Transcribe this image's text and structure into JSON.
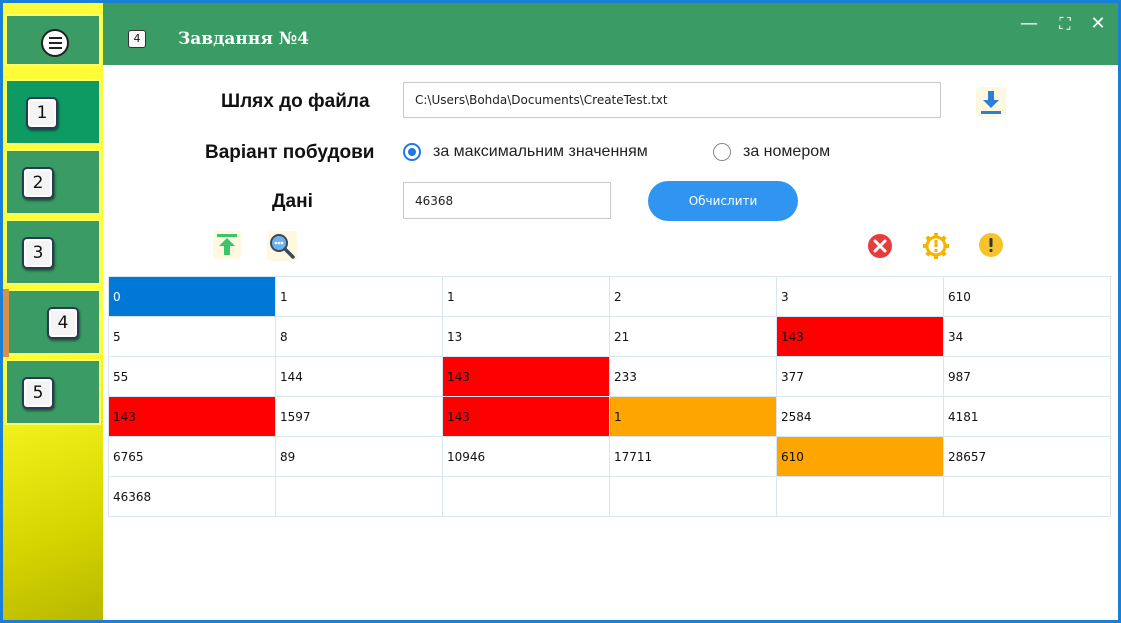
{
  "header": {
    "title": "Завдання №4",
    "task_badge": "4",
    "controls": {
      "minimize": "—",
      "maximize": "⛶",
      "close": "✕"
    }
  },
  "sidebar": {
    "menu_icon": "hamburger-menu-icon",
    "items": [
      {
        "label": "1",
        "active": true
      },
      {
        "label": "2",
        "active": false
      },
      {
        "label": "3",
        "active": false
      },
      {
        "label": "4",
        "active": false,
        "selected": true
      },
      {
        "label": "5",
        "active": false
      }
    ]
  },
  "form": {
    "path_label": "Шлях до файла",
    "path_value": "C:\\Users\\Bohda\\Documents\\CreateTest.txt",
    "variant_label": "Варіант побудови",
    "variant_options": [
      {
        "label": "за максимальним значенням",
        "checked": true
      },
      {
        "label": "за номером",
        "checked": false
      }
    ],
    "data_label": "Дані",
    "data_value": "46368",
    "calculate_label": "Обчислити"
  },
  "toolbar": {
    "download_icon": "download-icon",
    "upload_icon": "upload-icon",
    "search_icon": "search-icon",
    "clear_icon": "clear-icon",
    "settings_icon": "gear-icon",
    "warning_icon": "warning-icon"
  },
  "colors": {
    "accent_green": "#3a9b64",
    "selected_blue": "#0078d7",
    "highlight_red": "#ff0000",
    "highlight_orange": "#ffa500",
    "button_blue": "#2f95f0"
  },
  "grid": {
    "rows": [
      [
        {
          "v": "0",
          "bg": "blue"
        },
        {
          "v": "1"
        },
        {
          "v": "1"
        },
        {
          "v": "2"
        },
        {
          "v": "3"
        },
        {
          "v": "610"
        }
      ],
      [
        {
          "v": "5"
        },
        {
          "v": "8"
        },
        {
          "v": "13"
        },
        {
          "v": "21"
        },
        {
          "v": "143",
          "bg": "red"
        },
        {
          "v": "34"
        }
      ],
      [
        {
          "v": "55"
        },
        {
          "v": "144"
        },
        {
          "v": "143",
          "bg": "red"
        },
        {
          "v": "233"
        },
        {
          "v": "377"
        },
        {
          "v": "987"
        }
      ],
      [
        {
          "v": "143",
          "bg": "red"
        },
        {
          "v": "1597"
        },
        {
          "v": "143",
          "bg": "red"
        },
        {
          "v": "1",
          "bg": "orange"
        },
        {
          "v": "2584"
        },
        {
          "v": "4181"
        }
      ],
      [
        {
          "v": "6765"
        },
        {
          "v": "89"
        },
        {
          "v": "10946"
        },
        {
          "v": "17711"
        },
        {
          "v": "610",
          "bg": "orange"
        },
        {
          "v": "28657"
        }
      ],
      [
        {
          "v": "46368"
        },
        {
          "v": ""
        },
        {
          "v": ""
        },
        {
          "v": ""
        },
        {
          "v": ""
        },
        {
          "v": ""
        }
      ]
    ]
  }
}
